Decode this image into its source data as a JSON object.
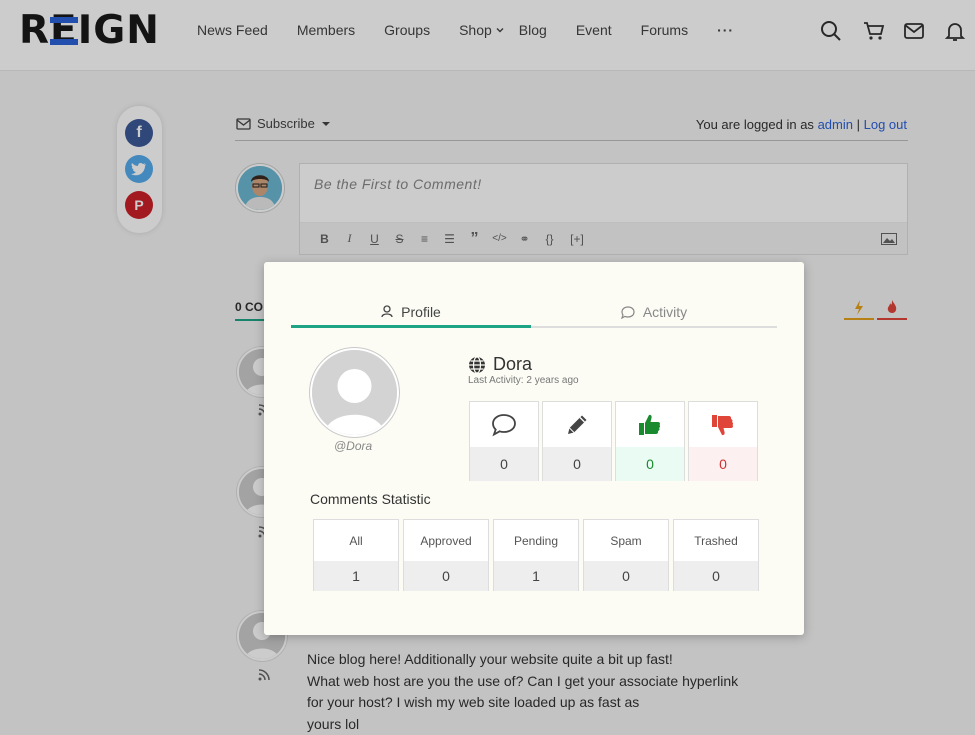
{
  "header": {
    "logo": "REIGN",
    "nav": [
      "News Feed",
      "Members",
      "Groups",
      "Shop",
      "Blog",
      "Event",
      "Forums"
    ],
    "more": "···"
  },
  "share": {
    "facebook_glyph": "f",
    "pinterest_glyph": "P"
  },
  "comments": {
    "subscribe_label": "Subscribe",
    "logged_in_prefix": "You are logged in as",
    "user_link": "admin",
    "separator": "|",
    "logout_link": "Log out",
    "editor_placeholder": "Be the First to Comment!",
    "toolbar": [
      "B",
      "I",
      "U",
      "S",
      "≡",
      "☰",
      "”",
      "</>",
      "⚭",
      "{}",
      "[+]"
    ],
    "count_label": "0 CO",
    "comment_text": [
      "Nice blog here! Additionally your website quite a bit up fast!",
      "What web host are you the use of? Can I get your associate hyperlink",
      "for your host? I wish my web site loaded up as fast as",
      "yours lol"
    ]
  },
  "popup": {
    "tabs": {
      "profile": "Profile",
      "activity": "Activity"
    },
    "username": "Dora",
    "handle": "@Dora",
    "last_activity": "Last Activity: 2 years ago",
    "stats": {
      "comments": "0",
      "edits": "0",
      "likes": "0",
      "dislikes": "0"
    },
    "comments_statistic_title": "Comments Statistic",
    "statistic": [
      {
        "label": "All",
        "value": "1"
      },
      {
        "label": "Approved",
        "value": "0"
      },
      {
        "label": "Pending",
        "value": "1"
      },
      {
        "label": "Spam",
        "value": "0"
      },
      {
        "label": "Trashed",
        "value": "0"
      }
    ]
  },
  "colors": {
    "accent": "#1fa385",
    "link": "#2b62d9",
    "facebook": "#3b5998",
    "twitter": "#55acee",
    "pinterest": "#cb2027"
  },
  "icons": [
    "search-icon",
    "cart-icon",
    "mail-icon",
    "bell-icon",
    "facebook-icon",
    "twitter-icon",
    "pinterest-icon",
    "envelope-icon",
    "user-icon",
    "chat-icon",
    "globe-icon",
    "pencil-icon",
    "thumbs-up-icon",
    "thumbs-down-icon",
    "bolt-icon",
    "fire-icon",
    "rss-icon",
    "image-icon"
  ]
}
